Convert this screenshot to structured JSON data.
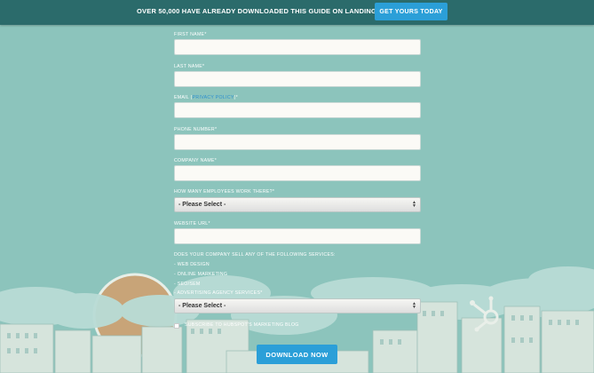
{
  "banner": {
    "text": "OVER 50,000 HAVE ALREADY DOWNLOADED THIS GUIDE ON LANDING PAGES",
    "cta": "GET YOURS TODAY"
  },
  "form": {
    "first_name": "FIRST NAME*",
    "last_name": "LAST NAME*",
    "email_prefix": "EMAIL (",
    "email_link": "PRIVACY POLICY",
    "email_suffix": ")*",
    "phone": "PHONE NUMBER*",
    "company": "COMPANY NAME*",
    "employees": "HOW MANY EMPLOYEES WORK THERE?*",
    "employees_select": "- Please Select -",
    "website": "WEBSITE URL*",
    "services_question": "DOES YOUR COMPANY SELL ANY OF THE FOLLOWING SERVICES:",
    "service_options": [
      "- WEB DESIGN",
      "- ONLINE MARKETING",
      "- SEO/SEM",
      "- ADVERTISING AGENCY SERVICES*"
    ],
    "services_select": "- Please Select -",
    "subscribe": "SUBSCRIBE TO HUBSPOT'S MARKETING BLOG",
    "submit": "DOWNLOAD NOW"
  },
  "colors": {
    "background": "#8cc4bc",
    "topbar": "#2b6b6b",
    "accent": "#2b9fd8"
  }
}
